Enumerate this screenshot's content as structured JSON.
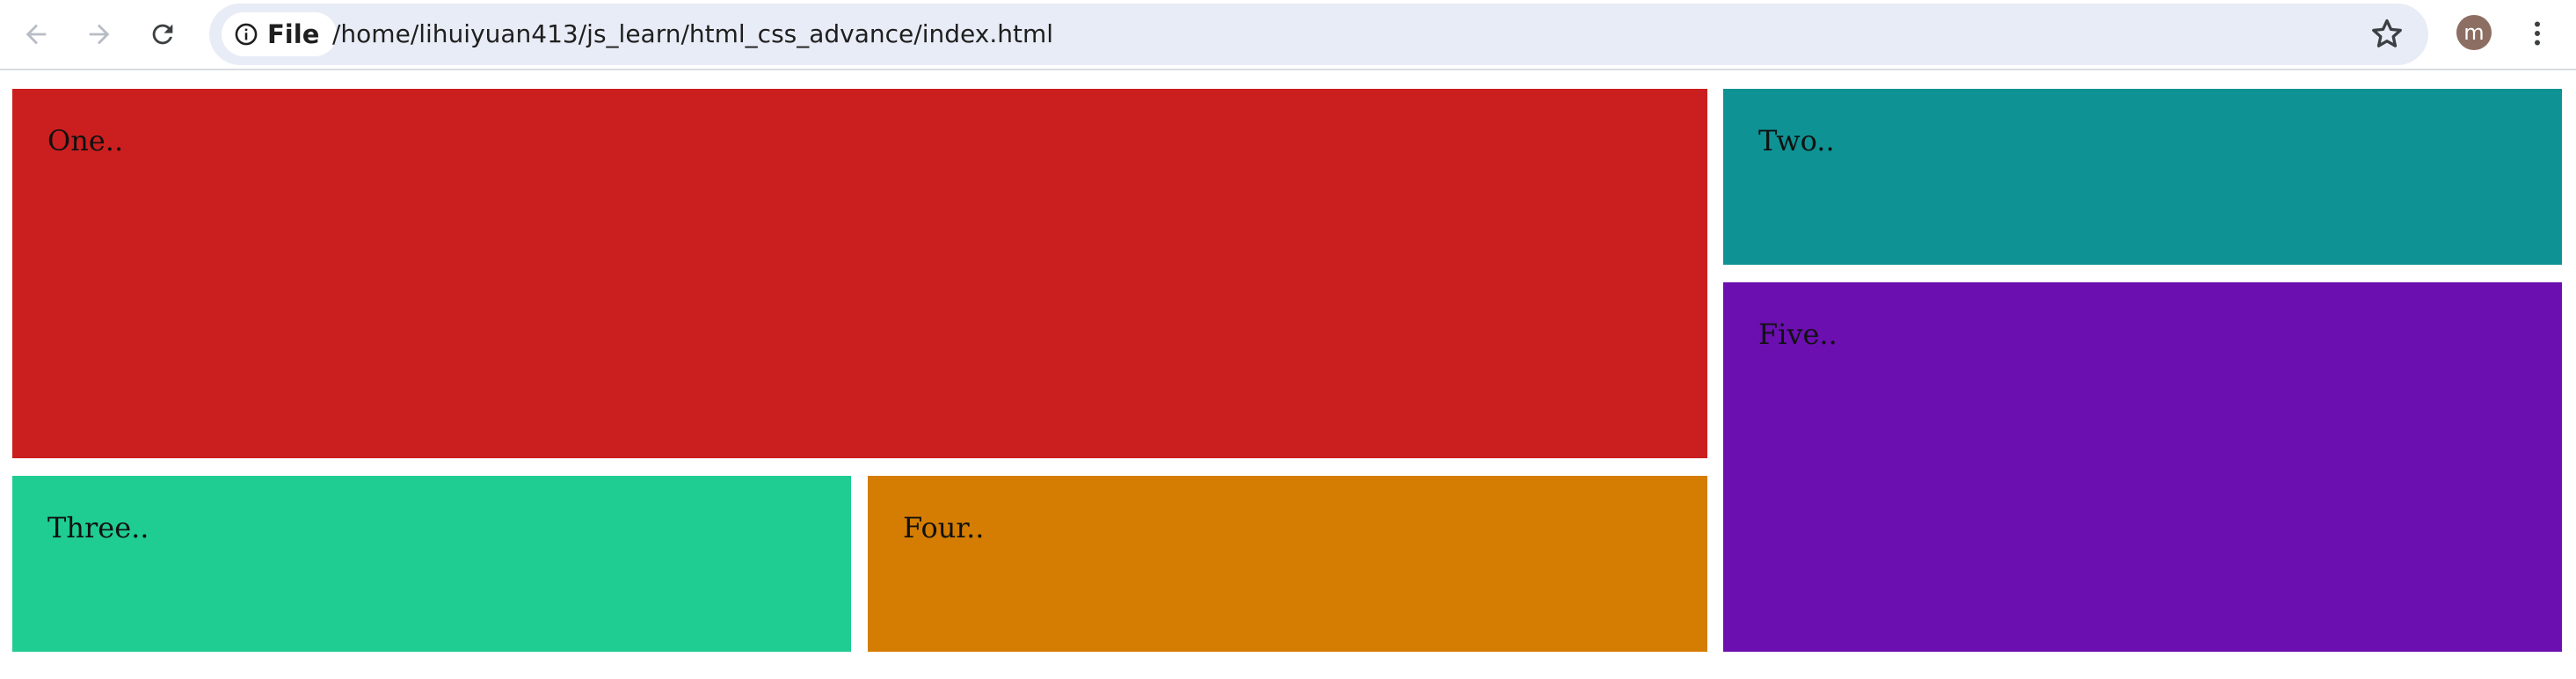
{
  "browser": {
    "chip_label": "File",
    "url": "/home/lihuiyuan413/js_learn/html_css_advance/index.html",
    "avatar_letter": "m",
    "icons": {
      "back": "arrow-left-icon",
      "forward": "arrow-right-icon",
      "reload": "reload-icon",
      "info": "info-icon",
      "bookmark": "star-icon",
      "menu": "kebab-menu-icon"
    },
    "avatar_color": "#8d6e63",
    "omnibox_color": "#e8ecf6"
  },
  "page": {
    "boxes": [
      {
        "id": "one",
        "label": "One..",
        "color": "#cb1f1f"
      },
      {
        "id": "two",
        "label": "Two..",
        "color": "#0e9294"
      },
      {
        "id": "five",
        "label": "Five..",
        "color": "#6b0fb0"
      },
      {
        "id": "three",
        "label": "Three..",
        "color": "#1fcc92"
      },
      {
        "id": "four",
        "label": "Four..",
        "color": "#d47d02"
      }
    ]
  }
}
